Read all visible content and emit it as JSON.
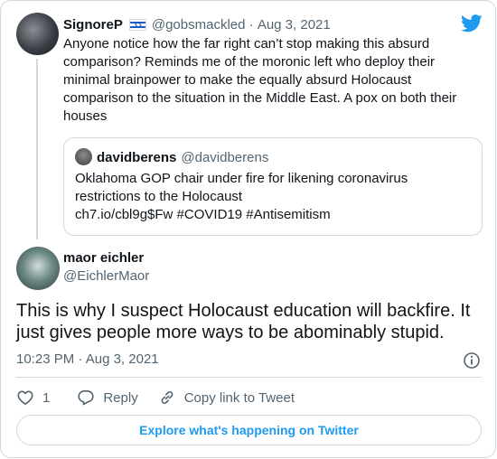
{
  "brand_color": "#1d9bf0",
  "reply_tweet": {
    "author_name": "SignoreP",
    "flag_icon": "israel-flag-icon",
    "handle": "@gobsmackled",
    "separator": " · ",
    "date": "Aug 3, 2021",
    "text": "Anyone notice how the far right can’t stop making this absurd comparison? Reminds me of the moronic left who deploy their minimal brainpower to make the equally absurd Holocaust comparison to the situation in the Middle East. A pox on both their houses",
    "quote": {
      "author_name": "davidberens",
      "handle": "@davidberens",
      "text_line1": "Oklahoma GOP chair under fire for likening coronavirus",
      "text_line2": "restrictions to the Holocaust",
      "text_line3": "ch7.io/cbl9g$Fw #COVID19 #Antisemitism"
    }
  },
  "main_tweet": {
    "author_name": "maor eichler",
    "handle": "@EichlerMaor",
    "text": "This is why I suspect Holocaust education will backfire. It just gives people more ways to be abominably stupid.",
    "time": "10:23 PM",
    "separator": " · ",
    "date": "Aug 3, 2021"
  },
  "actions": {
    "like_count": "1",
    "reply_label": "Reply",
    "copy_link_label": "Copy link to Tweet"
  },
  "explore_label": "Explore what's happening on Twitter"
}
